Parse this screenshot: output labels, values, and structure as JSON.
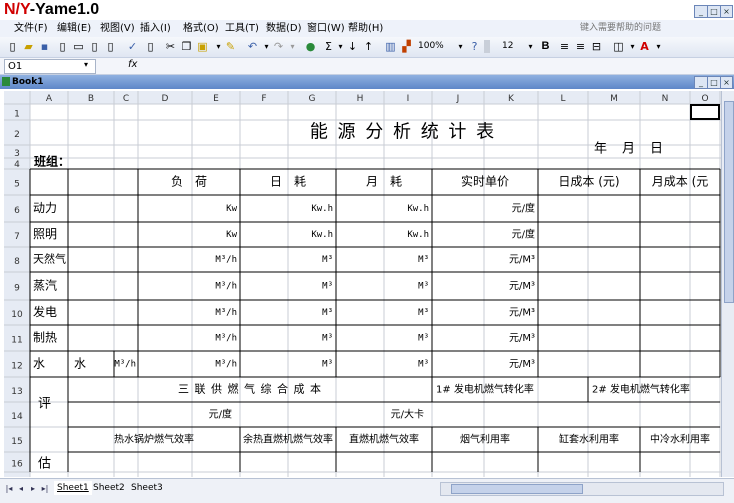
{
  "app": {
    "watermark_prefix": "N/Y",
    "watermark_suffix": "-Yame1.0"
  },
  "menu": {
    "items": [
      "文件(F)",
      "编辑(E)",
      "视图(V)",
      "插入(I)",
      "格式(O)",
      "工具(T)",
      "数据(D)",
      "窗口(W)",
      "帮助(H)"
    ],
    "help_placeholder": "键入需要帮助的问题"
  },
  "toolbar": {
    "zoom": "100%",
    "font_size": "12",
    "bold_label": "B"
  },
  "formula_bar": {
    "name_box": "O1",
    "fx_label": "fx"
  },
  "workbook": {
    "title": "Book1"
  },
  "sheet": {
    "columns": [
      "A",
      "B",
      "C",
      "D",
      "E",
      "F",
      "G",
      "H",
      "I",
      "J",
      "K",
      "L",
      "M",
      "N",
      "O"
    ],
    "rows": [
      "1",
      "2",
      "3",
      "4",
      "5",
      "6",
      "7",
      "8",
      "9",
      "10",
      "11",
      "12",
      "13",
      "14",
      "15",
      "16"
    ],
    "title": "能 源 分 析 统 计 表",
    "team_label": "班组：",
    "date_label": "年　月　日",
    "headers": [
      "负　荷",
      "日　耗",
      "月　耗",
      "实时单价",
      "日成本 (元)",
      "月成本 (元"
    ],
    "categories": [
      "动力",
      "照明",
      "天然气",
      "蒸汽",
      "发电",
      "制热",
      "水"
    ],
    "water_b": "水",
    "water_c": "M³/h",
    "units_load": [
      "Kw",
      "Kw",
      "M³/h",
      "M³/h",
      "M³/h",
      "M³/h",
      "M³/h"
    ],
    "units_day": [
      "Kw.h",
      "Kw.h",
      "M³",
      "M³",
      "M³",
      "M³",
      "M³"
    ],
    "units_month": [
      "Kw.h",
      "Kw.h",
      "M³",
      "M³",
      "M³",
      "M³",
      "M³"
    ],
    "units_price": [
      "元/度",
      "元/度",
      "元/M³",
      "元/M³",
      "元/M³",
      "元/M³",
      "元/M³"
    ],
    "eval_label_1": "评",
    "eval_label_2": "估",
    "row13_center": "三 联 供 燃 气 综 合 成 本",
    "row13_gen1": "1# 发电机燃气转化率",
    "row13_gen2": "2# 发电机燃气转化率",
    "row14_unit1": "元/度",
    "row14_unit2": "元/大卡",
    "row15_headers": [
      "热水锅炉燃气效率",
      "余热直燃机燃气效率",
      "直燃机燃气效率",
      "烟气利用率",
      "缸套水利用率",
      "中冷水利用率"
    ]
  },
  "tabs": [
    "Sheet1",
    "Sheet2",
    "Sheet3"
  ]
}
